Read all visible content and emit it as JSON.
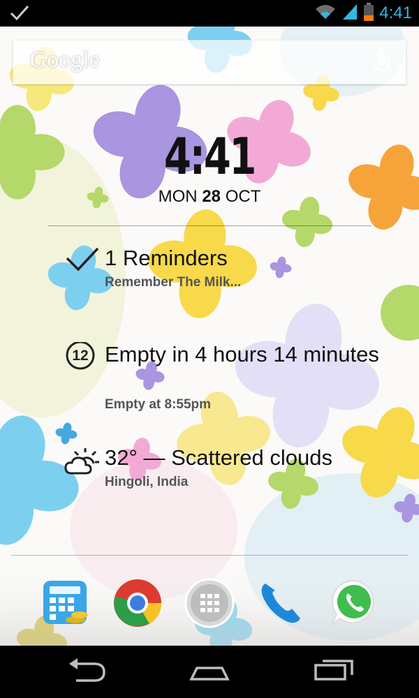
{
  "status_bar": {
    "time": "4:41",
    "icons": [
      "check-notification-icon",
      "wifi-icon",
      "signal-icon",
      "battery-icon"
    ],
    "accent": "#33b5e5"
  },
  "search": {
    "logo_text": "Google",
    "icon": "mic-icon"
  },
  "clock": {
    "time": "4:41",
    "weekday": "MON",
    "day": "28",
    "month": "OCT"
  },
  "info": {
    "reminders": {
      "title": "1 Reminders",
      "sub": "Remember The Milk...",
      "icon": "checkmark-icon"
    },
    "battery": {
      "title": "Empty in 4 hours 14 minutes",
      "sub": "Empty at 8:55pm",
      "icon": "battery-timer-icon",
      "icon_number": "12"
    },
    "weather": {
      "title": "32° — Scattered clouds",
      "sub": "Hingoli, India",
      "icon": "partly-cloudy-icon"
    }
  },
  "dock": {
    "apps": [
      "calculator-icon",
      "chrome-icon",
      "app-drawer-icon",
      "phone-icon",
      "whatsapp-icon"
    ]
  },
  "nav": {
    "buttons": [
      "back-icon",
      "home-icon",
      "recents-icon"
    ]
  }
}
